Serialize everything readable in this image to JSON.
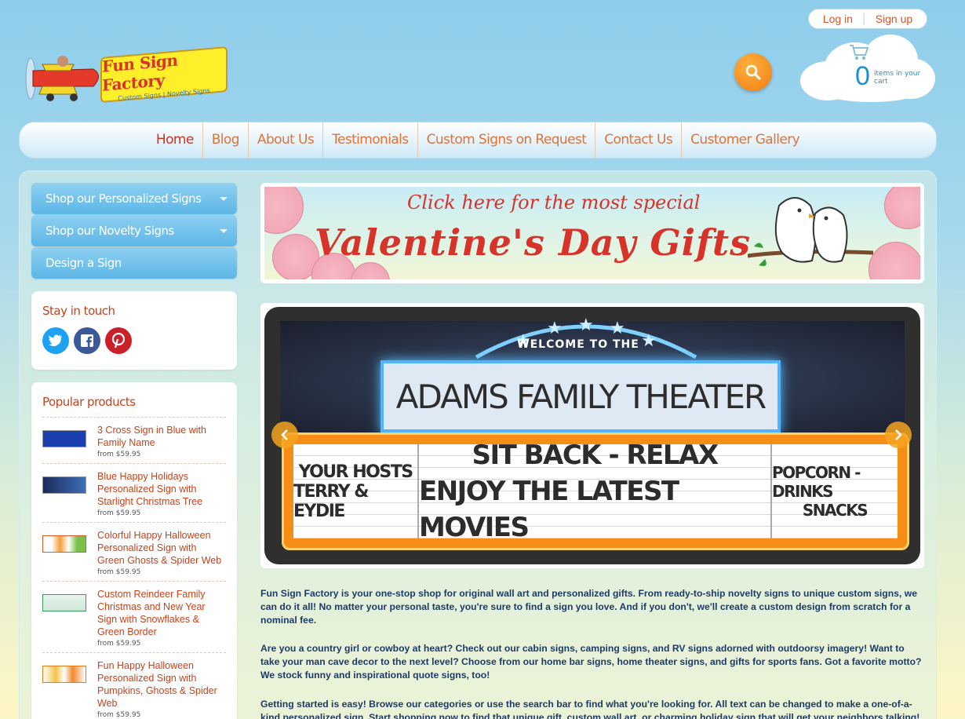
{
  "account": {
    "login": "Log in",
    "signup": "Sign up"
  },
  "logo": {
    "title": "Fun Sign Factory",
    "tagline": "Custom Signs | Novelty Signs"
  },
  "cart": {
    "count": "0",
    "label": "items in your cart"
  },
  "nav": [
    "Home",
    "Blog",
    "About Us",
    "Testimonials",
    "Custom Signs on Request",
    "Contact Us",
    "Customer Gallery"
  ],
  "sidebar": {
    "categories": [
      "Shop our Personalized Signs",
      "Shop our Novelty Signs",
      "Design a Sign"
    ],
    "stay_in_touch": "Stay in touch",
    "popular_title": "Popular products",
    "products": [
      {
        "name": "3 Cross Sign in Blue with Family Name",
        "price": "from $59.95"
      },
      {
        "name": "Blue Happy Holidays Personalized Sign with Starlight Christmas Tree",
        "price": "from $59.95"
      },
      {
        "name": "Colorful Happy Halloween Personalized Sign with Green Ghosts & Spider Web",
        "price": "from $59.95"
      },
      {
        "name": "Custom Reindeer Family Christmas and New Year Sign with Snowflakes & Green Border",
        "price": "from $59.95"
      },
      {
        "name": "Fun Happy Halloween Personalized Sign with Pumpkins, Ghosts & Spider Web",
        "price": "from $59.95"
      }
    ]
  },
  "promo": {
    "line1": "Click here for the most special",
    "line2": "Valentine's Day Gifts"
  },
  "slide": {
    "welcome": "WELCOME TO THE",
    "title": "ADAMS FAMILY THEATER",
    "left1": "YOUR HOSTS",
    "left2": "TERRY & EYDIE",
    "mid1": "SIT BACK - RELAX",
    "mid2": "ENJOY THE LATEST MOVIES",
    "right1": "POPCORN - DRINKS",
    "right2": "SNACKS"
  },
  "description": [
    "Fun Sign Factory is your one-stop shop for original wall art and personalized gifts. From ready-to-ship novelty signs to unique custom signs, we can do it all! No matter your personal taste, you're sure to find a sign you love. And if you don't, we'll create a custom design from scratch for a nominal fee.",
    "Are you a country girl or cowboy at heart? Check out our cabin signs, camping signs, and RV signs adorned with outdoorsy imagery! Want to take your man cave decor to the next level? Choose from our home bar signs, home theater signs, and gifts for sports fans. Got a favorite motto? We stock funny and inspirational quote signs, too!",
    "Getting started is easy! Browse our categories or use the search bar to find what you're looking for. All text can be changed to make a one-of-a-kind personalized sign. Start shopping now to find that unique gift, custom wall art, or charming holiday sign that will get your neighbors talking!"
  ],
  "colors": {
    "accent": "#d5572a",
    "nav_link": "#e07238",
    "sidebar_button": "#5cb6e6",
    "search": "#f07c10"
  }
}
